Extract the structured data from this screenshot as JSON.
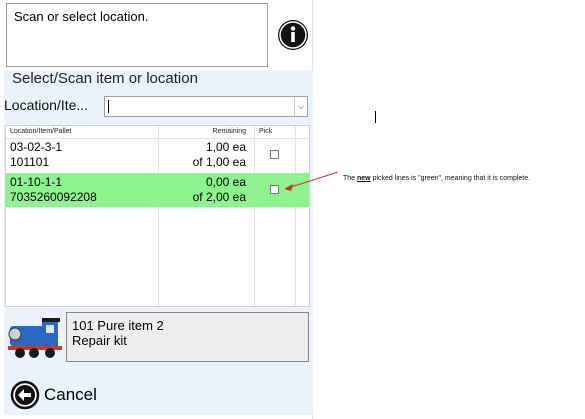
{
  "message": "Scan or select location.",
  "section_title": "Select/Scan item or location",
  "location_label": "Location/Ite...",
  "table": {
    "headers": [
      "Location/Item/Pallet",
      "Remaining",
      "Pick"
    ],
    "rows": [
      {
        "line1": "03-02-3-1",
        "line2": "101101",
        "rem1": "1,00 ea",
        "rem2": "of 1,00 ea",
        "checked": false,
        "complete": false
      },
      {
        "line1": "01-10-1-1",
        "line2": "7035260092208",
        "rem1": "0,00 ea",
        "rem2": "of 2,00 ea",
        "checked": false,
        "complete": true
      }
    ]
  },
  "item": {
    "line1": "101 Pure item 2",
    "line2": "Repair kit"
  },
  "cancel_label": "Cancel",
  "annotation": {
    "pre": "The ",
    "emph": "new",
    "post": " picked lines is \"green\", meaning that it is complete."
  },
  "colors": {
    "complete_row": "#8ef28e",
    "panel": "#eaf3fb",
    "arrow": "#c0392b"
  },
  "icons": {
    "info": "info-icon",
    "cancel": "back-arrow-icon",
    "thumb": "toy-train-image"
  }
}
